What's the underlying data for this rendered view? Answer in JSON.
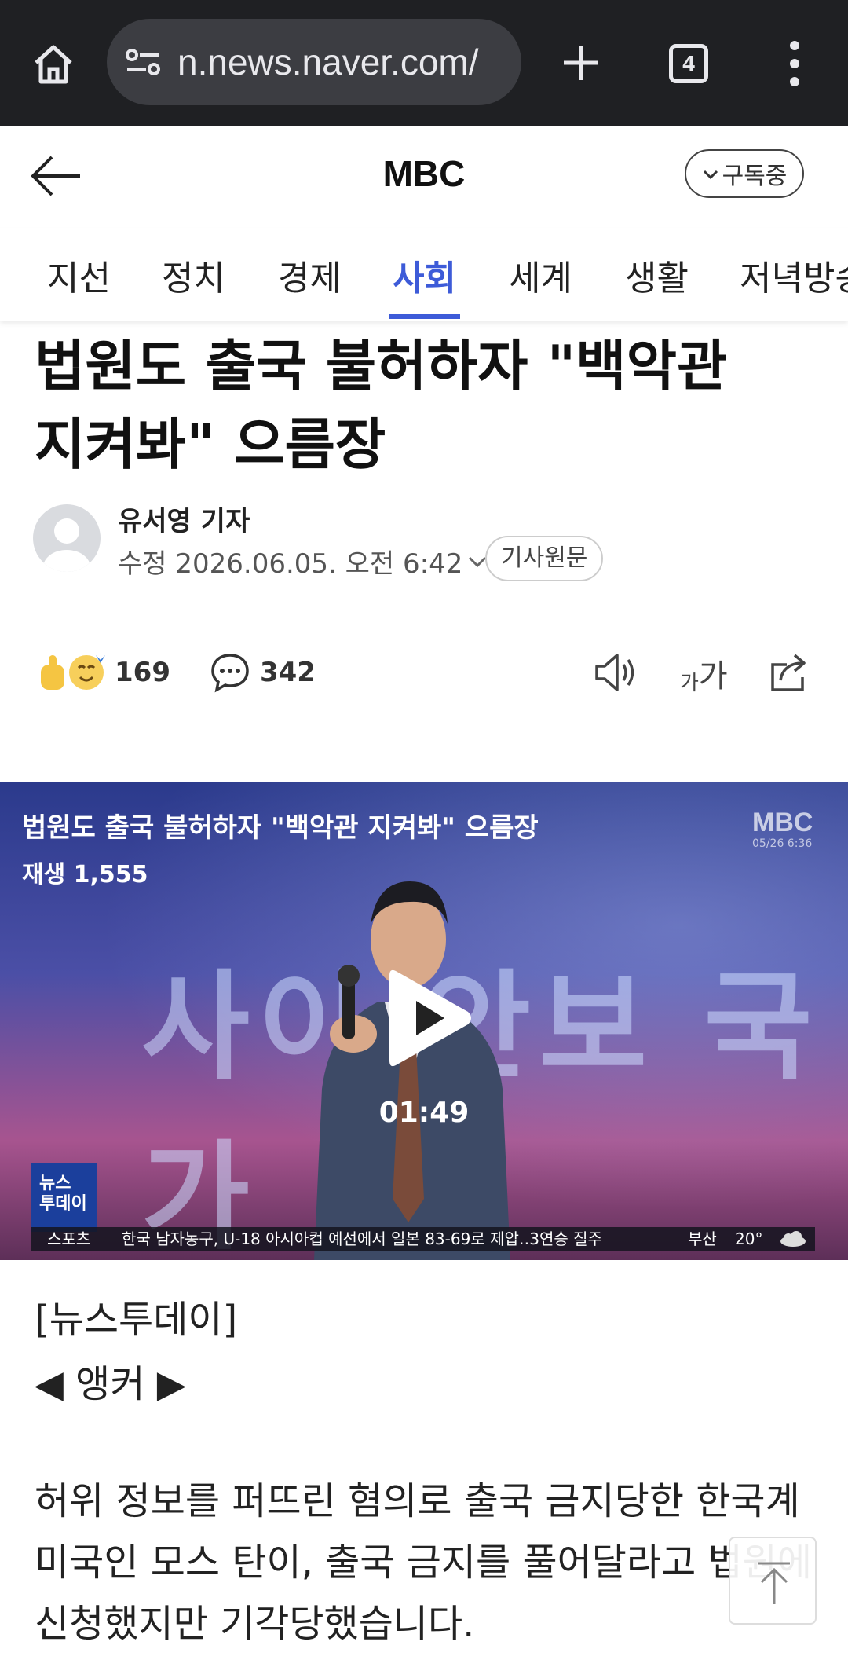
{
  "browser": {
    "url": "n.news.naver.com/",
    "tab_count": "4"
  },
  "header": {
    "title": "MBC",
    "subscribe_label": "구독중"
  },
  "tabs": [
    {
      "label": "지선"
    },
    {
      "label": "정치"
    },
    {
      "label": "경제"
    },
    {
      "label": "사회",
      "active": true
    },
    {
      "label": "세계"
    },
    {
      "label": "생활"
    },
    {
      "label": "저녁방송"
    }
  ],
  "article": {
    "headline_line1": "법원도 출국 불허하자 \"백악관",
    "headline_line2": "지켜봐\" 으름장",
    "reporter": "유서영 기자",
    "dateline": "수정 2026.06.05. 오전 6:42",
    "original_label": "기사원문",
    "reaction_count": "169",
    "comment_count": "342",
    "font_size_label_small": "가",
    "font_size_label_large": "가"
  },
  "video": {
    "title": "법원도 출국 불허하자 \"백악관 지켜봐\" 으름장",
    "plays": "재생 1,555",
    "duration": "01:49",
    "background_text": "사이 안보 국가",
    "channel_logo": "MBC",
    "channel_date": "05/26 6:36",
    "program_logo_line1": "뉴스",
    "program_logo_line2": "투데이",
    "ticker_category": "스포츠",
    "ticker_text": "한국 남자농구, U-18 아시아컵 예선에서 일본 83-69로 제압‥3연승 질주",
    "ticker_city": "부산",
    "ticker_temp": "20°"
  },
  "body": {
    "program_tag": "[뉴스투데이]",
    "anchor": "◀ 앵커 ▶",
    "paragraph": "허위 정보를 퍼뜨린 혐의로 출국 금지당한 한국계 미국인 모스 탄이, 출국 금지를 풀어달라고 법원에 신청했지만 기각당했습니다."
  },
  "colors": {
    "accent": "#3d5bd8",
    "chrome_bg": "#1f2023"
  }
}
